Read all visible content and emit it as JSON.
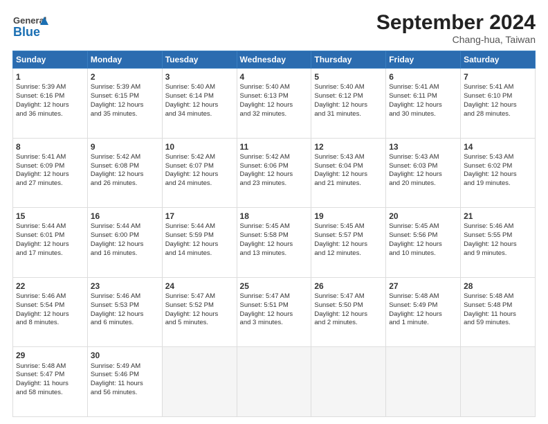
{
  "header": {
    "logo_general": "General",
    "logo_blue": "Blue",
    "month_title": "September 2024",
    "subtitle": "Chang-hua, Taiwan"
  },
  "weekdays": [
    "Sunday",
    "Monday",
    "Tuesday",
    "Wednesday",
    "Thursday",
    "Friday",
    "Saturday"
  ],
  "weeks": [
    [
      {
        "day": "1",
        "info": "Sunrise: 5:39 AM\nSunset: 6:16 PM\nDaylight: 12 hours\nand 36 minutes."
      },
      {
        "day": "2",
        "info": "Sunrise: 5:39 AM\nSunset: 6:15 PM\nDaylight: 12 hours\nand 35 minutes."
      },
      {
        "day": "3",
        "info": "Sunrise: 5:40 AM\nSunset: 6:14 PM\nDaylight: 12 hours\nand 34 minutes."
      },
      {
        "day": "4",
        "info": "Sunrise: 5:40 AM\nSunset: 6:13 PM\nDaylight: 12 hours\nand 32 minutes."
      },
      {
        "day": "5",
        "info": "Sunrise: 5:40 AM\nSunset: 6:12 PM\nDaylight: 12 hours\nand 31 minutes."
      },
      {
        "day": "6",
        "info": "Sunrise: 5:41 AM\nSunset: 6:11 PM\nDaylight: 12 hours\nand 30 minutes."
      },
      {
        "day": "7",
        "info": "Sunrise: 5:41 AM\nSunset: 6:10 PM\nDaylight: 12 hours\nand 28 minutes."
      }
    ],
    [
      {
        "day": "8",
        "info": "Sunrise: 5:41 AM\nSunset: 6:09 PM\nDaylight: 12 hours\nand 27 minutes."
      },
      {
        "day": "9",
        "info": "Sunrise: 5:42 AM\nSunset: 6:08 PM\nDaylight: 12 hours\nand 26 minutes."
      },
      {
        "day": "10",
        "info": "Sunrise: 5:42 AM\nSunset: 6:07 PM\nDaylight: 12 hours\nand 24 minutes."
      },
      {
        "day": "11",
        "info": "Sunrise: 5:42 AM\nSunset: 6:06 PM\nDaylight: 12 hours\nand 23 minutes."
      },
      {
        "day": "12",
        "info": "Sunrise: 5:43 AM\nSunset: 6:04 PM\nDaylight: 12 hours\nand 21 minutes."
      },
      {
        "day": "13",
        "info": "Sunrise: 5:43 AM\nSunset: 6:03 PM\nDaylight: 12 hours\nand 20 minutes."
      },
      {
        "day": "14",
        "info": "Sunrise: 5:43 AM\nSunset: 6:02 PM\nDaylight: 12 hours\nand 19 minutes."
      }
    ],
    [
      {
        "day": "15",
        "info": "Sunrise: 5:44 AM\nSunset: 6:01 PM\nDaylight: 12 hours\nand 17 minutes."
      },
      {
        "day": "16",
        "info": "Sunrise: 5:44 AM\nSunset: 6:00 PM\nDaylight: 12 hours\nand 16 minutes."
      },
      {
        "day": "17",
        "info": "Sunrise: 5:44 AM\nSunset: 5:59 PM\nDaylight: 12 hours\nand 14 minutes."
      },
      {
        "day": "18",
        "info": "Sunrise: 5:45 AM\nSunset: 5:58 PM\nDaylight: 12 hours\nand 13 minutes."
      },
      {
        "day": "19",
        "info": "Sunrise: 5:45 AM\nSunset: 5:57 PM\nDaylight: 12 hours\nand 12 minutes."
      },
      {
        "day": "20",
        "info": "Sunrise: 5:45 AM\nSunset: 5:56 PM\nDaylight: 12 hours\nand 10 minutes."
      },
      {
        "day": "21",
        "info": "Sunrise: 5:46 AM\nSunset: 5:55 PM\nDaylight: 12 hours\nand 9 minutes."
      }
    ],
    [
      {
        "day": "22",
        "info": "Sunrise: 5:46 AM\nSunset: 5:54 PM\nDaylight: 12 hours\nand 8 minutes."
      },
      {
        "day": "23",
        "info": "Sunrise: 5:46 AM\nSunset: 5:53 PM\nDaylight: 12 hours\nand 6 minutes."
      },
      {
        "day": "24",
        "info": "Sunrise: 5:47 AM\nSunset: 5:52 PM\nDaylight: 12 hours\nand 5 minutes."
      },
      {
        "day": "25",
        "info": "Sunrise: 5:47 AM\nSunset: 5:51 PM\nDaylight: 12 hours\nand 3 minutes."
      },
      {
        "day": "26",
        "info": "Sunrise: 5:47 AM\nSunset: 5:50 PM\nDaylight: 12 hours\nand 2 minutes."
      },
      {
        "day": "27",
        "info": "Sunrise: 5:48 AM\nSunset: 5:49 PM\nDaylight: 12 hours\nand 1 minute."
      },
      {
        "day": "28",
        "info": "Sunrise: 5:48 AM\nSunset: 5:48 PM\nDaylight: 11 hours\nand 59 minutes."
      }
    ],
    [
      {
        "day": "29",
        "info": "Sunrise: 5:48 AM\nSunset: 5:47 PM\nDaylight: 11 hours\nand 58 minutes."
      },
      {
        "day": "30",
        "info": "Sunrise: 5:49 AM\nSunset: 5:46 PM\nDaylight: 11 hours\nand 56 minutes."
      },
      {
        "day": "",
        "info": ""
      },
      {
        "day": "",
        "info": ""
      },
      {
        "day": "",
        "info": ""
      },
      {
        "day": "",
        "info": ""
      },
      {
        "day": "",
        "info": ""
      }
    ]
  ]
}
